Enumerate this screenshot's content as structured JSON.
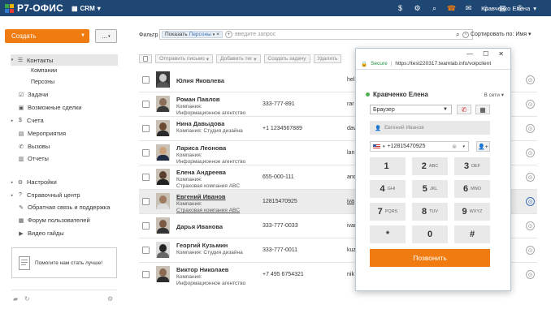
{
  "app": {
    "logo_text": "Р7-ОФИС",
    "module": "CRM",
    "user": "Кравченко Елена"
  },
  "topbar": {
    "icons": [
      "dollar-icon",
      "gear-icon",
      "search-icon",
      "phone-icon",
      "mail-icon",
      "people-icon",
      "calendar-icon",
      "phone-small-icon"
    ]
  },
  "actions": {
    "create_label": "Создать",
    "more_label": "..."
  },
  "nav": {
    "contacts": "Контакты",
    "companies": "Компании",
    "persons": "Персоны",
    "tasks": "Задачи",
    "deals": "Возможные сделки",
    "invoices": "Счета",
    "events": "Мероприятия",
    "calls": "Вызовы",
    "reports": "Отчеты",
    "settings": "Настройки",
    "help": "Справочный центр",
    "feedback": "Обратная связь и поддержка",
    "forum": "Форум пользователей",
    "video": "Видео гайды"
  },
  "helpbox": {
    "text": "Помогите нам стать лучше!"
  },
  "filter": {
    "label": "Фильтр",
    "chip_key": "Показать",
    "chip_val": "Персоны",
    "placeholder": "введите запрос",
    "sort_label": "Сортировать по:",
    "sort_value": "Имя"
  },
  "toolbar": {
    "send": "Отправить письмо",
    "tag": "Добавить тег",
    "task": "Создать задачу",
    "delete": "Удалить"
  },
  "contacts": [
    {
      "name": "Юлия Яковлева",
      "company_label": "",
      "company": "",
      "phone": "",
      "email": "hel"
    },
    {
      "name": "Роман Павлов",
      "company_label": "Компания:",
      "company": "Информационное агентство",
      "phone": "333-777-891",
      "email": "rar"
    },
    {
      "name": "Нина Давыдова",
      "company_label": "Компания:",
      "company": "Студия дизайна",
      "phone": "+1 1234567889",
      "email": "dav"
    },
    {
      "name": "Лариса Леонова",
      "company_label": "Компания:",
      "company": "Информационное агентство",
      "phone": "",
      "email": "lan"
    },
    {
      "name": "Елена Андреева",
      "company_label": "Компания:",
      "company": "Страховая компания ABC",
      "phone": "655-000-111",
      "email": "and"
    },
    {
      "name": "Евгений Иванов",
      "company_label": "Компания:",
      "company": "Страховая компания ABC",
      "phone": "12815470925",
      "email": "iva"
    },
    {
      "name": "Дарья Иванова",
      "company_label": "",
      "company": "",
      "phone": "333-777-0033",
      "email": "ivar"
    },
    {
      "name": "Георгий Кузьмин",
      "company_label": "Компания:",
      "company": "Студия дизайна",
      "phone": "333-777-0011",
      "email": "kuz"
    },
    {
      "name": "Виктор Николаев",
      "company_label": "Компания:",
      "company": "Информационное агентство",
      "phone": "+7 495 6754321",
      "email": "nik"
    }
  ],
  "popup": {
    "secure": "Secure",
    "url": "https://test220317.teamlab.info/voipclient",
    "operator": "Кравченко Елена",
    "status": "В сети",
    "device": "Браузер",
    "contact": "Евгений Иванов",
    "number": "+12815470925",
    "keys": [
      {
        "d": "1",
        "l": ""
      },
      {
        "d": "2",
        "l": "ABC"
      },
      {
        "d": "3",
        "l": "DEF"
      },
      {
        "d": "4",
        "l": "GHI"
      },
      {
        "d": "5",
        "l": "JKL"
      },
      {
        "d": "6",
        "l": "MNO"
      },
      {
        "d": "7",
        "l": "PQRS"
      },
      {
        "d": "8",
        "l": "TUV"
      },
      {
        "d": "9",
        "l": "WXYZ"
      },
      {
        "d": "*",
        "l": ""
      },
      {
        "d": "0",
        "l": ""
      },
      {
        "d": "#",
        "l": ""
      }
    ],
    "call_label": "Позвонить"
  },
  "colors": {
    "topbar": "#1e4774",
    "accent": "#f07b10",
    "online": "#4caf50"
  }
}
